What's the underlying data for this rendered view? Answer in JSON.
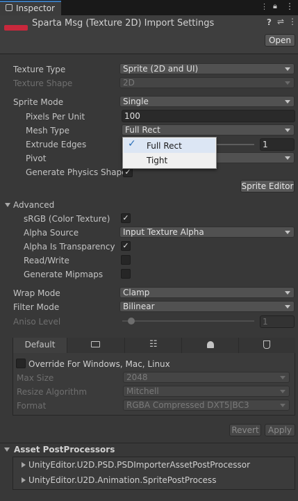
{
  "window": {
    "tab_title": "Inspector"
  },
  "header": {
    "title": "Sparta Msg (Texture 2D) Import Settings",
    "open_label": "Open"
  },
  "texture": {
    "type_label": "Texture Type",
    "type_value": "Sprite (2D and UI)",
    "shape_label": "Texture Shape",
    "shape_value": "2D"
  },
  "sprite": {
    "mode_label": "Sprite Mode",
    "mode_value": "Single",
    "ppu_label": "Pixels Per Unit",
    "ppu_value": "100",
    "mesh_label": "Mesh Type",
    "mesh_value": "Full Rect",
    "extrude_label": "Extrude Edges",
    "extrude_value": "1",
    "pivot_label": "Pivot",
    "physics_label": "Generate Physics Shape",
    "editor_label": "Sprite Editor"
  },
  "mesh_dropdown": {
    "options": [
      "Full Rect",
      "Tight"
    ],
    "selected": "Full Rect"
  },
  "advanced": {
    "title": "Advanced",
    "srgb_label": "sRGB (Color Texture)",
    "srgb_checked": true,
    "alpha_source_label": "Alpha Source",
    "alpha_source_value": "Input Texture Alpha",
    "alpha_transp_label": "Alpha Is Transparency",
    "alpha_transp_checked": true,
    "rw_label": "Read/Write",
    "rw_checked": false,
    "mip_label": "Generate Mipmaps",
    "mip_checked": false
  },
  "wrap": {
    "label": "Wrap Mode",
    "value": "Clamp"
  },
  "filter": {
    "label": "Filter Mode",
    "value": "Bilinear"
  },
  "aniso": {
    "label": "Aniso Level",
    "value": "1"
  },
  "platform": {
    "tabs": [
      "Default",
      "monitor-icon",
      "grid-icon",
      "android-icon",
      "html5-icon"
    ],
    "override_label": "Override For Windows, Mac, Linux",
    "max_size_label": "Max Size",
    "max_size_value": "2048",
    "resize_label": "Resize Algorithm",
    "resize_value": "Mitchell",
    "format_label": "Format",
    "format_value": "RGBA Compressed DXT5|BC3"
  },
  "actions": {
    "revert": "Revert",
    "apply": "Apply"
  },
  "postprocessors": {
    "title": "Asset PostProcessors",
    "items": [
      "UnityEditor.U2D.PSD.PSDImporterAssetPostProcessor",
      "UnityEditor.U2D.Animation.SpritePostProcess"
    ]
  },
  "colors": {
    "accent": "#3a79bb",
    "background": "#383838",
    "thumbnail": "#c8283c"
  }
}
